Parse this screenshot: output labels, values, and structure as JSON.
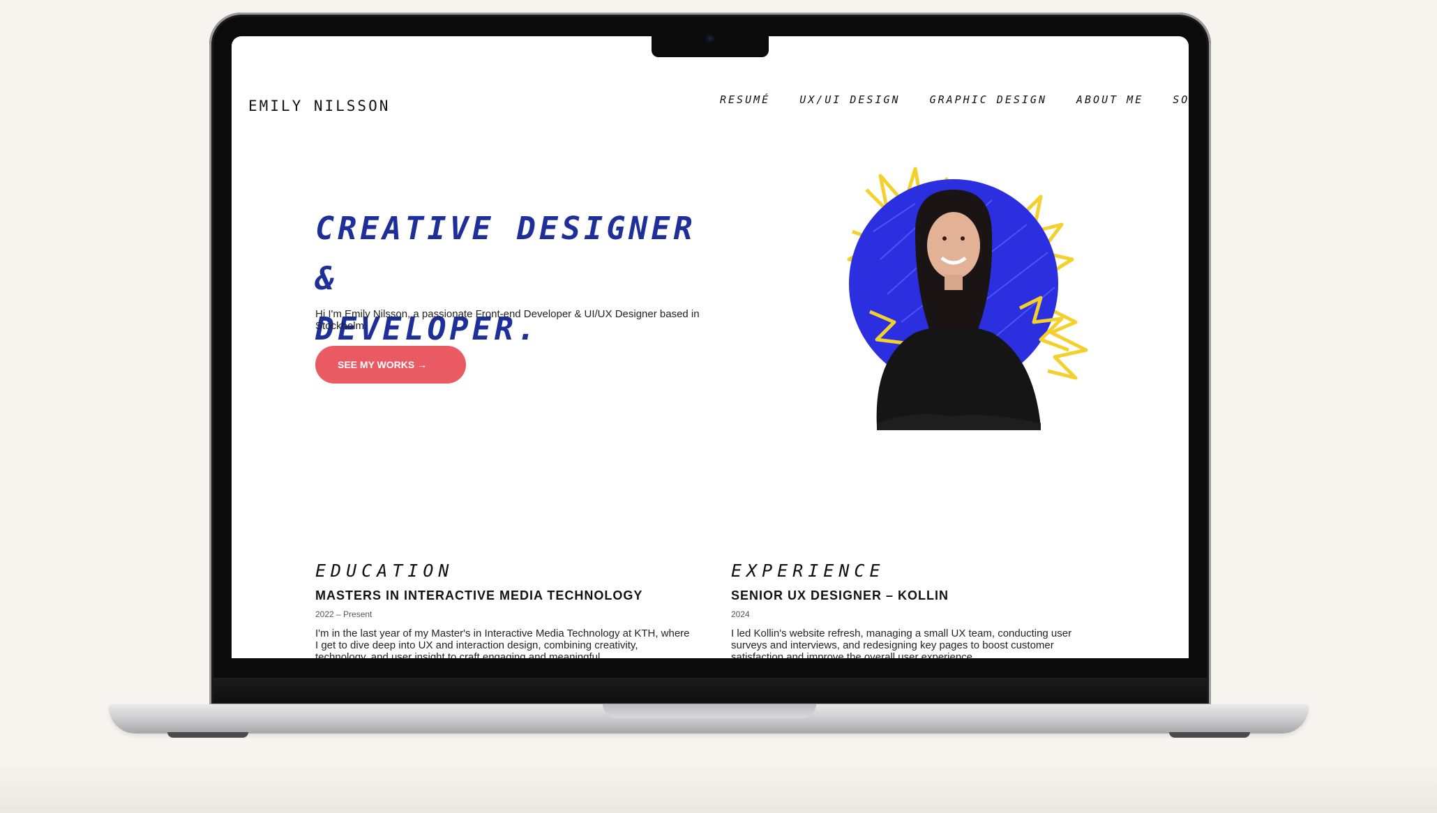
{
  "site": {
    "brand": "EMILY NILSSON",
    "nav": [
      "RESUMÉ",
      "UX/UI DESIGN",
      "GRAPHIC DESIGN",
      "ABOUT ME",
      "SOCIALS"
    ]
  },
  "hero": {
    "title_line1": "CREATIVE DESIGNER &",
    "title_line2": "DEVELOPER.",
    "intro": "Hi I'm Emily Nilsson, a passionate Front-end Developer & UI/UX Designer based in Stockholm.",
    "cta_label": "SEE MY WORKS →"
  },
  "education": {
    "heading": "EDUCATION",
    "title": "MASTERS IN INTERACTIVE MEDIA TECHNOLOGY",
    "date": "2022 – Present",
    "desc": "I'm in the last year of my Master's in Interactive Media Technology at KTH, where I get to dive deep into UX and interaction design, combining creativity, technology, and user insight to craft engaging and meaningful"
  },
  "experience": {
    "heading": "EXPERIENCE",
    "title": "SENIOR UX DESIGNER – KOLLIN",
    "date": "2024",
    "desc": "I led Kollin's website refresh, managing a small UX team, conducting user surveys and interviews, and redesigning key pages to boost customer satisfaction and improve the overall user experience."
  },
  "colors": {
    "accent_blue": "#1f2f99",
    "cta_red": "#ea5a63",
    "circle_blue": "#2b2fe0",
    "burst_yellow": "#f4d02c"
  }
}
